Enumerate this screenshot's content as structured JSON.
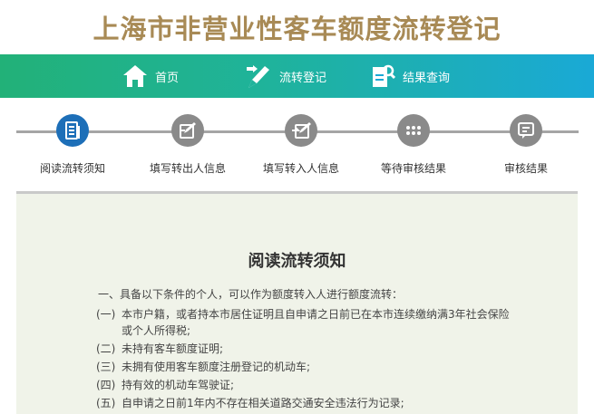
{
  "header": {
    "title": "上海市非营业性客车额度流转登记"
  },
  "nav": {
    "items": [
      {
        "label": "首页",
        "icon": "home-icon"
      },
      {
        "label": "流转登记",
        "icon": "pen-icon"
      },
      {
        "label": "结果查询",
        "icon": "search-document-icon"
      }
    ]
  },
  "steps": {
    "items": [
      {
        "label": "阅读流转须知",
        "icon": "document-icon",
        "active": true
      },
      {
        "label": "填写转出人信息",
        "icon": "transfer-out-icon",
        "active": false
      },
      {
        "label": "填写转入人信息",
        "icon": "transfer-in-icon",
        "active": false
      },
      {
        "label": "等待审核结果",
        "icon": "waiting-dots-icon",
        "active": false
      },
      {
        "label": "审核结果",
        "icon": "result-icon",
        "active": false
      }
    ]
  },
  "notice": {
    "title": "阅读流转须知",
    "intro": "一、具备以下条件的个人，可以作为额度转入人进行额度流转：",
    "conditions": [
      {
        "num": "(一)",
        "text": "本市户籍，或者持本市居住证明且自申请之日前已在本市连续缴纳满3年社会保险",
        "cont": "或个人所得税;"
      },
      {
        "num": "(二)",
        "text": "未持有客车额度证明;"
      },
      {
        "num": "(三)",
        "text": "未拥有使用客车额度注册登记的机动车;"
      },
      {
        "num": "(四)",
        "text": "持有效的机动车驾驶证;"
      },
      {
        "num": "(五)",
        "text": "自申请之日前1年内不存在相关道路交通安全违法行为记录;"
      }
    ]
  },
  "colors": {
    "title": "#a88a55",
    "nav_start": "#22b178",
    "nav_end": "#1aa9d6",
    "step_active": "#1d6fb8",
    "step_inactive": "#8a8a8a",
    "content_bg": "#f0f3e9"
  }
}
